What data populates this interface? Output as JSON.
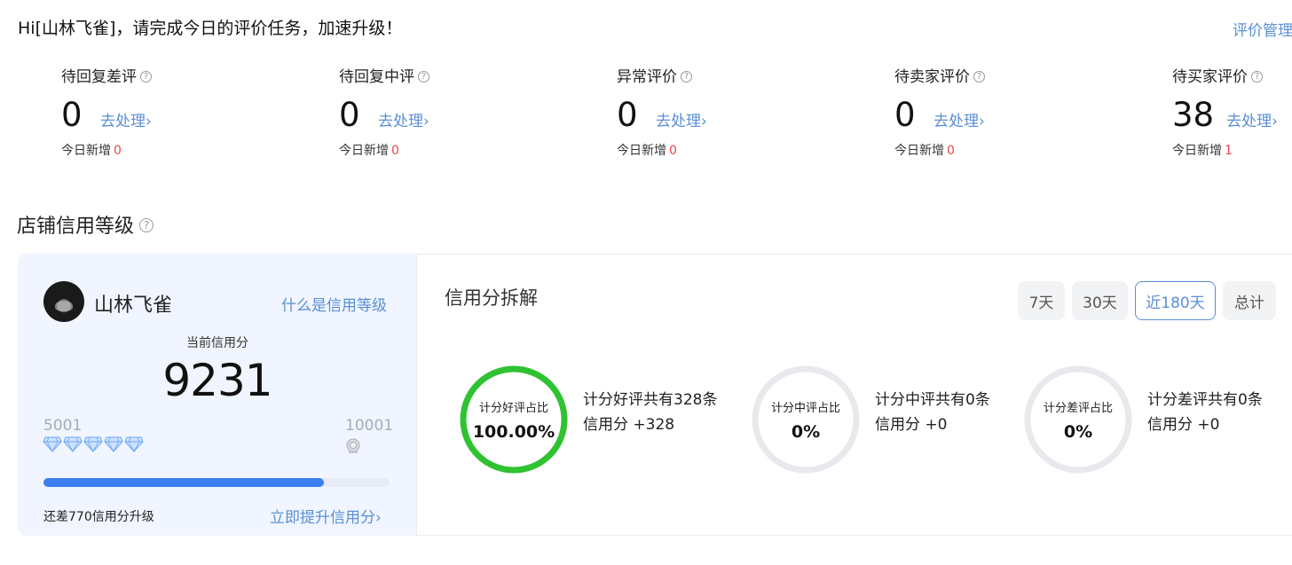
{
  "greeting": "Hi[山林飞雀]，请完成今日的评价任务，加速升级！",
  "manage_link": "评价管理",
  "stats": [
    {
      "title": "待回复差评",
      "value": "0",
      "link": "去处理",
      "new_label": "今日新增",
      "new_count": "0"
    },
    {
      "title": "待回复中评",
      "value": "0",
      "link": "去处理",
      "new_label": "今日新增",
      "new_count": "0"
    },
    {
      "title": "异常评价",
      "value": "0",
      "link": "去处理",
      "new_label": "今日新增",
      "new_count": "0"
    },
    {
      "title": "待卖家评价",
      "value": "0",
      "link": "去处理",
      "new_label": "今日新增",
      "new_count": "0"
    },
    {
      "title": "待买家评价",
      "value": "38",
      "link": "去处理",
      "new_label": "今日新增",
      "new_count": "1"
    }
  ],
  "credit_section": {
    "title": "店铺信用等级",
    "shop_name": "山林飞雀",
    "what_link": "什么是信用等级",
    "current_label": "当前信用分",
    "current_value": "9231",
    "range_min": "5001",
    "range_max": "10001",
    "progress": 0.81,
    "remaining_text": "还差770信用分升级",
    "boost_link": "立即提升信用分"
  },
  "breakdown": {
    "title": "信用分拆解",
    "tabs": [
      "7天",
      "30天",
      "近180天",
      "总计"
    ],
    "active_tab": "近180天",
    "rings": [
      {
        "label": "计分好评占比",
        "value": "100.00%",
        "fraction": 1.0,
        "color": "#2fc231",
        "desc_line1": "计分好评共有328条",
        "desc_line2": "信用分 +328"
      },
      {
        "label": "计分中评占比",
        "value": "0%",
        "fraction": 0,
        "color": "#e8e9ed",
        "desc_line1": "计分中评共有0条",
        "desc_line2": "信用分 +0"
      },
      {
        "label": "计分差评占比",
        "value": "0%",
        "fraction": 0,
        "color": "#e8e9ed",
        "desc_line1": "计分差评共有0条",
        "desc_line2": "信用分 +0"
      }
    ]
  },
  "colors": {
    "link": "#5a8fd6",
    "red": "#e5484d",
    "progress": "#3b7ff0",
    "card_bg": "#f0f5ff"
  },
  "icons": {
    "help": "question-circle-icon",
    "diamond": "diamond-icon",
    "crown": "crown-icon",
    "chevron": "chevron-right-icon"
  }
}
